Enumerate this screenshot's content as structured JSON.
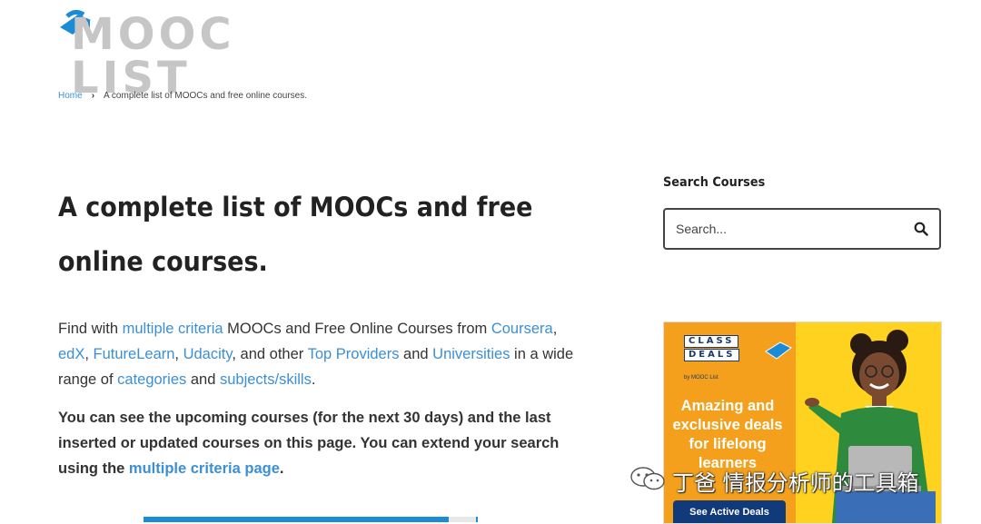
{
  "logo": {
    "text": "MOOC LIST",
    "icon": "graduation-cap-icon",
    "icon_color": "#1c8bd6"
  },
  "breadcrumb": {
    "home": "Home",
    "separator": "›",
    "current": "A complete list of MOOCs and free online courses."
  },
  "page": {
    "title": "A complete list of MOOCs and free online courses."
  },
  "intro": {
    "t1": "Find with ",
    "l1": "multiple criteria",
    "t2": " MOOCs and Free Online Courses from ",
    "l2": "Coursera",
    "t3": ", ",
    "l3": "edX",
    "t4": ", ",
    "l4": "FutureLearn",
    "t5": ", ",
    "l5": "Udacity",
    "t6": ", and other ",
    "l6": "Top Providers",
    "t7": " and ",
    "l7": "Universities",
    "t8": " in a wide range of ",
    "l8": "categories",
    "t9": " and ",
    "l9": "subjects/skills",
    "t10": "."
  },
  "intro_bold": {
    "text": "You can see the upcoming courses (for the next 30 days) and the last inserted or updated courses on this page. You can extend your search using the ",
    "link": "multiple criteria page",
    "end": "."
  },
  "sidebar": {
    "search_heading": "Search Courses",
    "search_placeholder": "Search...",
    "search_icon": "search-icon"
  },
  "banner": {
    "logo_line1": "CLASS",
    "logo_line2": "DEALS",
    "logo_by": "by MOOC List",
    "headline": "Amazing and exclusive deals for lifelong learners",
    "button": "See Active Deals"
  },
  "watermark": {
    "text": "丁爸 情报分析师的工具箱",
    "icon": "wechat-icon"
  },
  "colors": {
    "link": "#3b8fd6",
    "accent": "#1c8bd6",
    "banner_orange": "#f4a01c",
    "banner_yellow": "#ffd21f",
    "banner_button": "#103a7a"
  }
}
